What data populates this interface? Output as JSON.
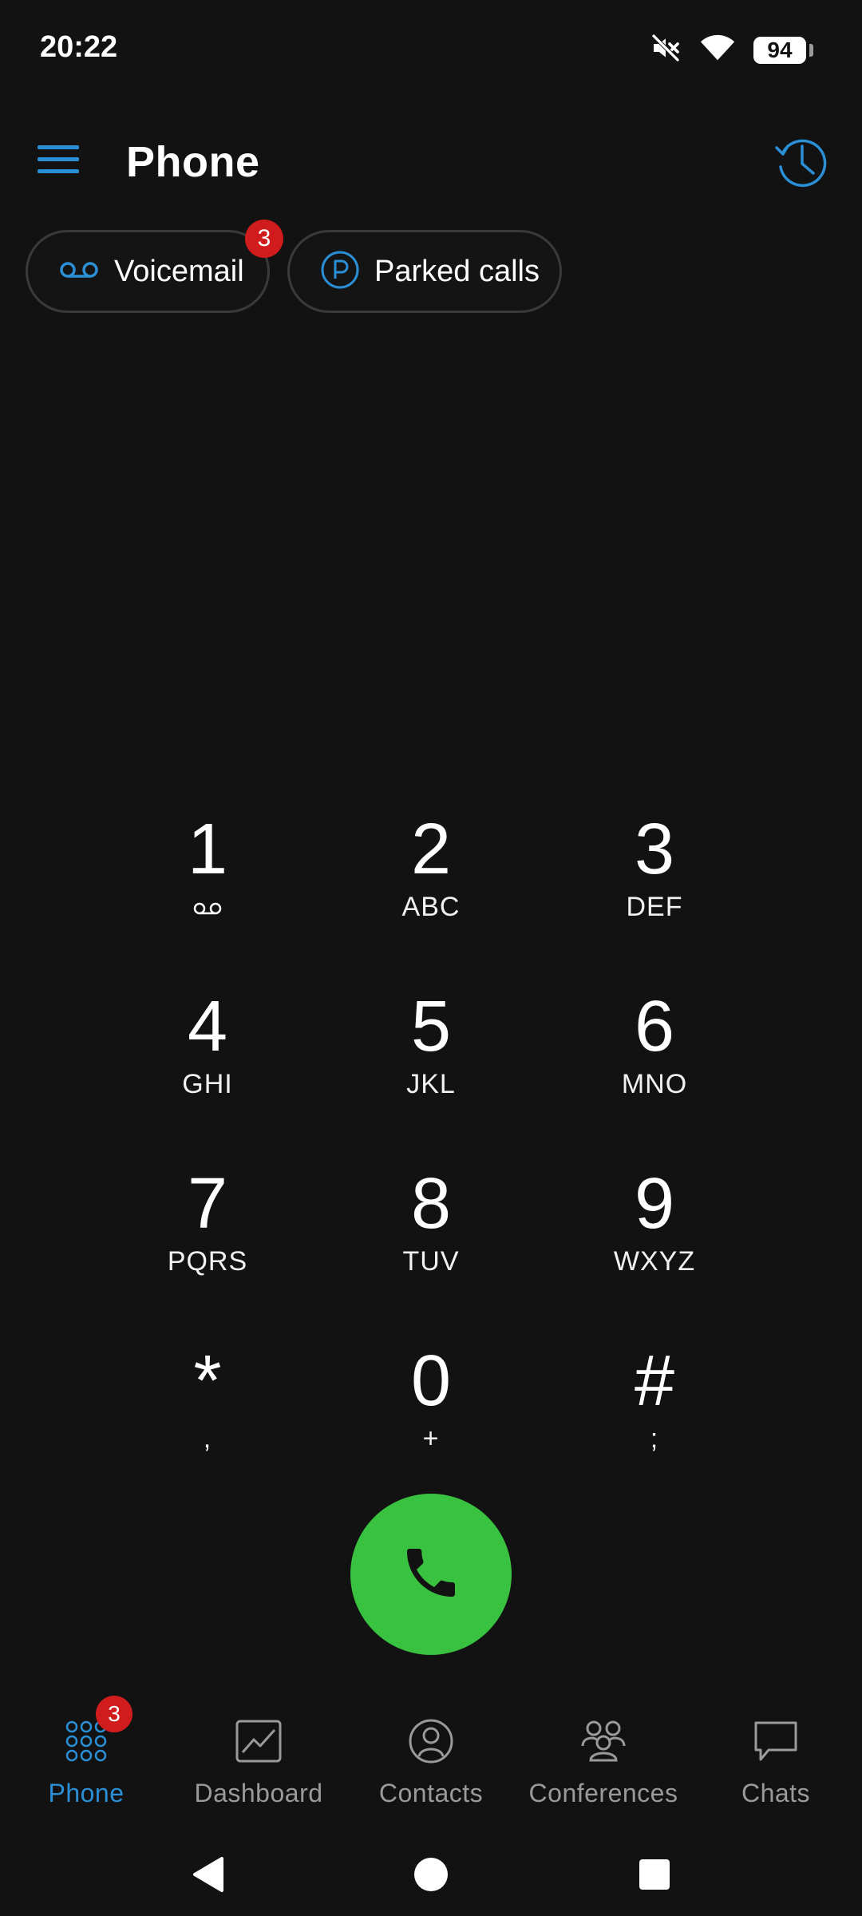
{
  "status_bar": {
    "time": "20:22",
    "battery": "94"
  },
  "app_bar": {
    "title": "Phone"
  },
  "chips": {
    "voicemail": {
      "label": "Voicemail",
      "badge": "3"
    },
    "parked": {
      "label": "Parked calls"
    }
  },
  "dialpad": {
    "keys": [
      {
        "digit": "1",
        "letters": ""
      },
      {
        "digit": "2",
        "letters": "ABC"
      },
      {
        "digit": "3",
        "letters": "DEF"
      },
      {
        "digit": "4",
        "letters": "GHI"
      },
      {
        "digit": "5",
        "letters": "JKL"
      },
      {
        "digit": "6",
        "letters": "MNO"
      },
      {
        "digit": "7",
        "letters": "PQRS"
      },
      {
        "digit": "8",
        "letters": "TUV"
      },
      {
        "digit": "9",
        "letters": "WXYZ"
      },
      {
        "digit": "*",
        "letters": ","
      },
      {
        "digit": "0",
        "letters": "+"
      },
      {
        "digit": "#",
        "letters": ";"
      }
    ]
  },
  "bottom_nav": {
    "items": [
      {
        "label": "Phone",
        "badge": "3"
      },
      {
        "label": "Dashboard"
      },
      {
        "label": "Contacts"
      },
      {
        "label": "Conferences"
      },
      {
        "label": "Chats"
      }
    ]
  },
  "colors": {
    "accent": "#2b8fd6",
    "call_green": "#38c240",
    "badge_red": "#d01c1c",
    "background": "#121212"
  },
  "icons": {
    "menu": "hamburger-menu-icon",
    "history": "clock-history-icon",
    "voicemail": "voicemail-icon",
    "parked": "parking-icon",
    "call": "phone-handset-icon"
  }
}
